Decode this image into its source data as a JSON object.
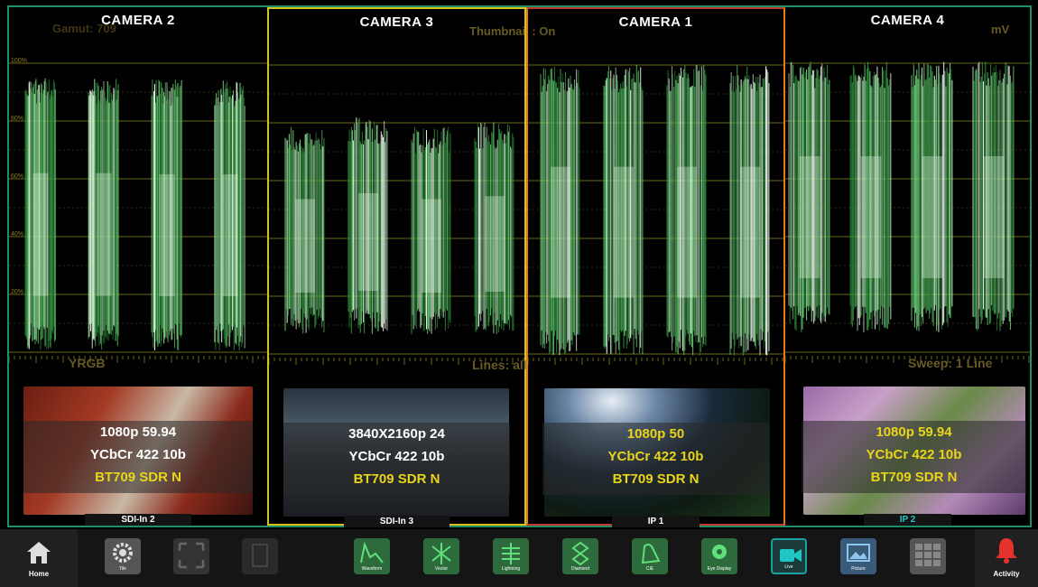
{
  "overlay": {
    "thumbnail_label": "Thumbnail : On",
    "gamut_label": "Gamut: 709",
    "mv_label": "mV",
    "mode_label": "YRGB",
    "lines_label": "Lines: all",
    "sweep_label": "Sweep: 1 Line",
    "scale_ticks": [
      "100%",
      "80%",
      "60%",
      "40%",
      "20%"
    ]
  },
  "panels": [
    {
      "title": "CAMERA 2",
      "format": "1080p 59.94",
      "color": "YCbCr 422 10b",
      "hdr": "BT709 SDR N",
      "source": "SDI-In 2",
      "border": "#1f8f6a",
      "format_color": "white"
    },
    {
      "title": "CAMERA 3",
      "format": "3840X2160p 24",
      "color": "YCbCr 422 10b",
      "hdr": "BT709 SDR N",
      "source": "SDI-In 3",
      "border": "#d6c21c",
      "format_color": "white"
    },
    {
      "title": "CAMERA 1",
      "format": "1080p 50",
      "color": "YCbCr 422 10b",
      "hdr": "BT709 SDR N",
      "source": "IP 1",
      "border": "#c0392b",
      "format_color": "yellow"
    },
    {
      "title": "CAMERA 4",
      "format": "1080p 59.94",
      "color": "YCbCr 422 10b",
      "hdr": "BT709 SDR N",
      "source": "IP 2",
      "border": "#e07a1c",
      "format_color": "yellow"
    }
  ],
  "toolbar": {
    "home": "Home",
    "tile": "Tile",
    "waveform": "Waveform",
    "vector": "Vector",
    "lightning": "Lightning",
    "diamond": "Diamond",
    "cie": "CIE",
    "eye_display": "Eye Display",
    "live": "Live",
    "picture": "Picture",
    "activity": "Activity"
  },
  "colors": {
    "trace": "#3fbf5a",
    "graticule": "#6b6a10",
    "button_green": "#2e6b3c",
    "button_gray": "#555555",
    "button_live": "#1aa0a0",
    "activity_red": "#e5322d"
  }
}
